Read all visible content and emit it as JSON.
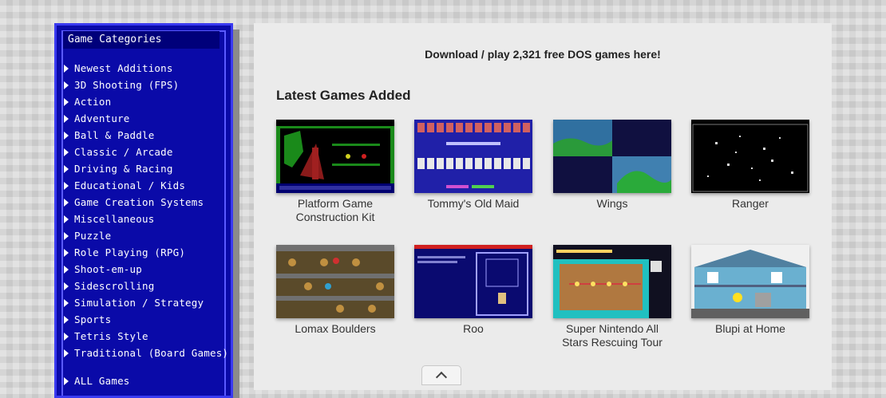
{
  "sidebar": {
    "header": "Game Categories",
    "categories": [
      "Newest Additions",
      "3D Shooting (FPS)",
      "Action",
      "Adventure",
      "Ball & Paddle",
      "Classic / Arcade",
      "Driving & Racing",
      "Educational / Kids",
      "Game Creation Systems",
      "Miscellaneous",
      "Puzzle",
      "Role Playing (RPG)",
      "Shoot-em-up",
      "Sidescrolling",
      "Simulation / Strategy",
      "Sports",
      "Tetris Style",
      "Traditional (Board Games)"
    ],
    "all_games": "ALL Games"
  },
  "main": {
    "banner": "Download / play 2,321 free DOS games here!",
    "section_title": "Latest Games Added",
    "games": [
      {
        "title": "Platform Game Construction Kit"
      },
      {
        "title": "Tommy's Old Maid"
      },
      {
        "title": "Wings"
      },
      {
        "title": "Ranger"
      },
      {
        "title": "Lomax Boulders"
      },
      {
        "title": "Roo"
      },
      {
        "title": "Super Nintendo All Stars Rescuing Tour"
      },
      {
        "title": "Blupi at Home"
      }
    ]
  },
  "colors": {
    "sidebar_bg": "#0a0aa8",
    "sidebar_border": "#3a3af0",
    "panel_bg": "#ebebeb",
    "page_bg": "#d6d6d6"
  },
  "icons": {
    "category_bullet": "triangle-right-icon",
    "scroll_top": "chevron-up-icon"
  }
}
